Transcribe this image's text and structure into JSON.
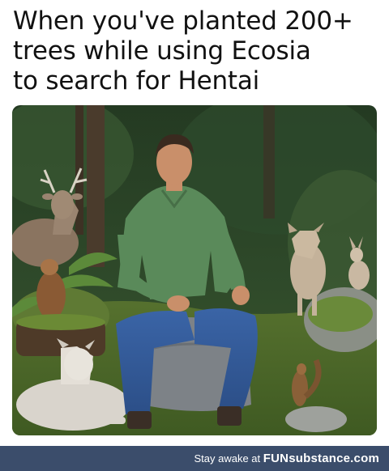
{
  "caption": {
    "line1": "When you've planted 200+",
    "line2": "trees while using Ecosia",
    "line3": "to search for Hentai"
  },
  "footer": {
    "tagline": "Stay awake at",
    "brand_prefix": "FUN",
    "brand_suffix": "substance.com"
  },
  "colors": {
    "footer_bg": "#3b4d6b",
    "caption_text": "#111111"
  }
}
